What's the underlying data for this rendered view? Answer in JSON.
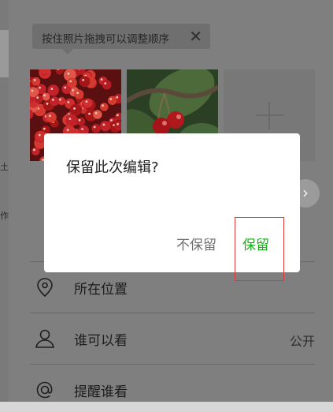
{
  "side_glyphs": [
    "土",
    "作"
  ],
  "tip": {
    "text": "按住照片拖拽可以调整顺序",
    "close_glyph": "✕"
  },
  "photos": [
    {
      "subject": "cherry pile"
    },
    {
      "subject": "cherries on branch"
    }
  ],
  "add_photo": {
    "icon": "plus-icon"
  },
  "next_arrow": {
    "glyph": "›"
  },
  "list": [
    {
      "icon": "location-icon",
      "label": "所在位置",
      "value": ""
    },
    {
      "icon": "person-icon",
      "label": "谁可以看",
      "value": "公开"
    },
    {
      "icon": "at-icon",
      "label": "提醒谁看",
      "value": ""
    }
  ],
  "dialog": {
    "title": "保留此次编辑?",
    "discard_label": "不保留",
    "keep_label": "保留"
  },
  "colors": {
    "keep": "#1aad19",
    "highlight": "#e03b3b"
  }
}
